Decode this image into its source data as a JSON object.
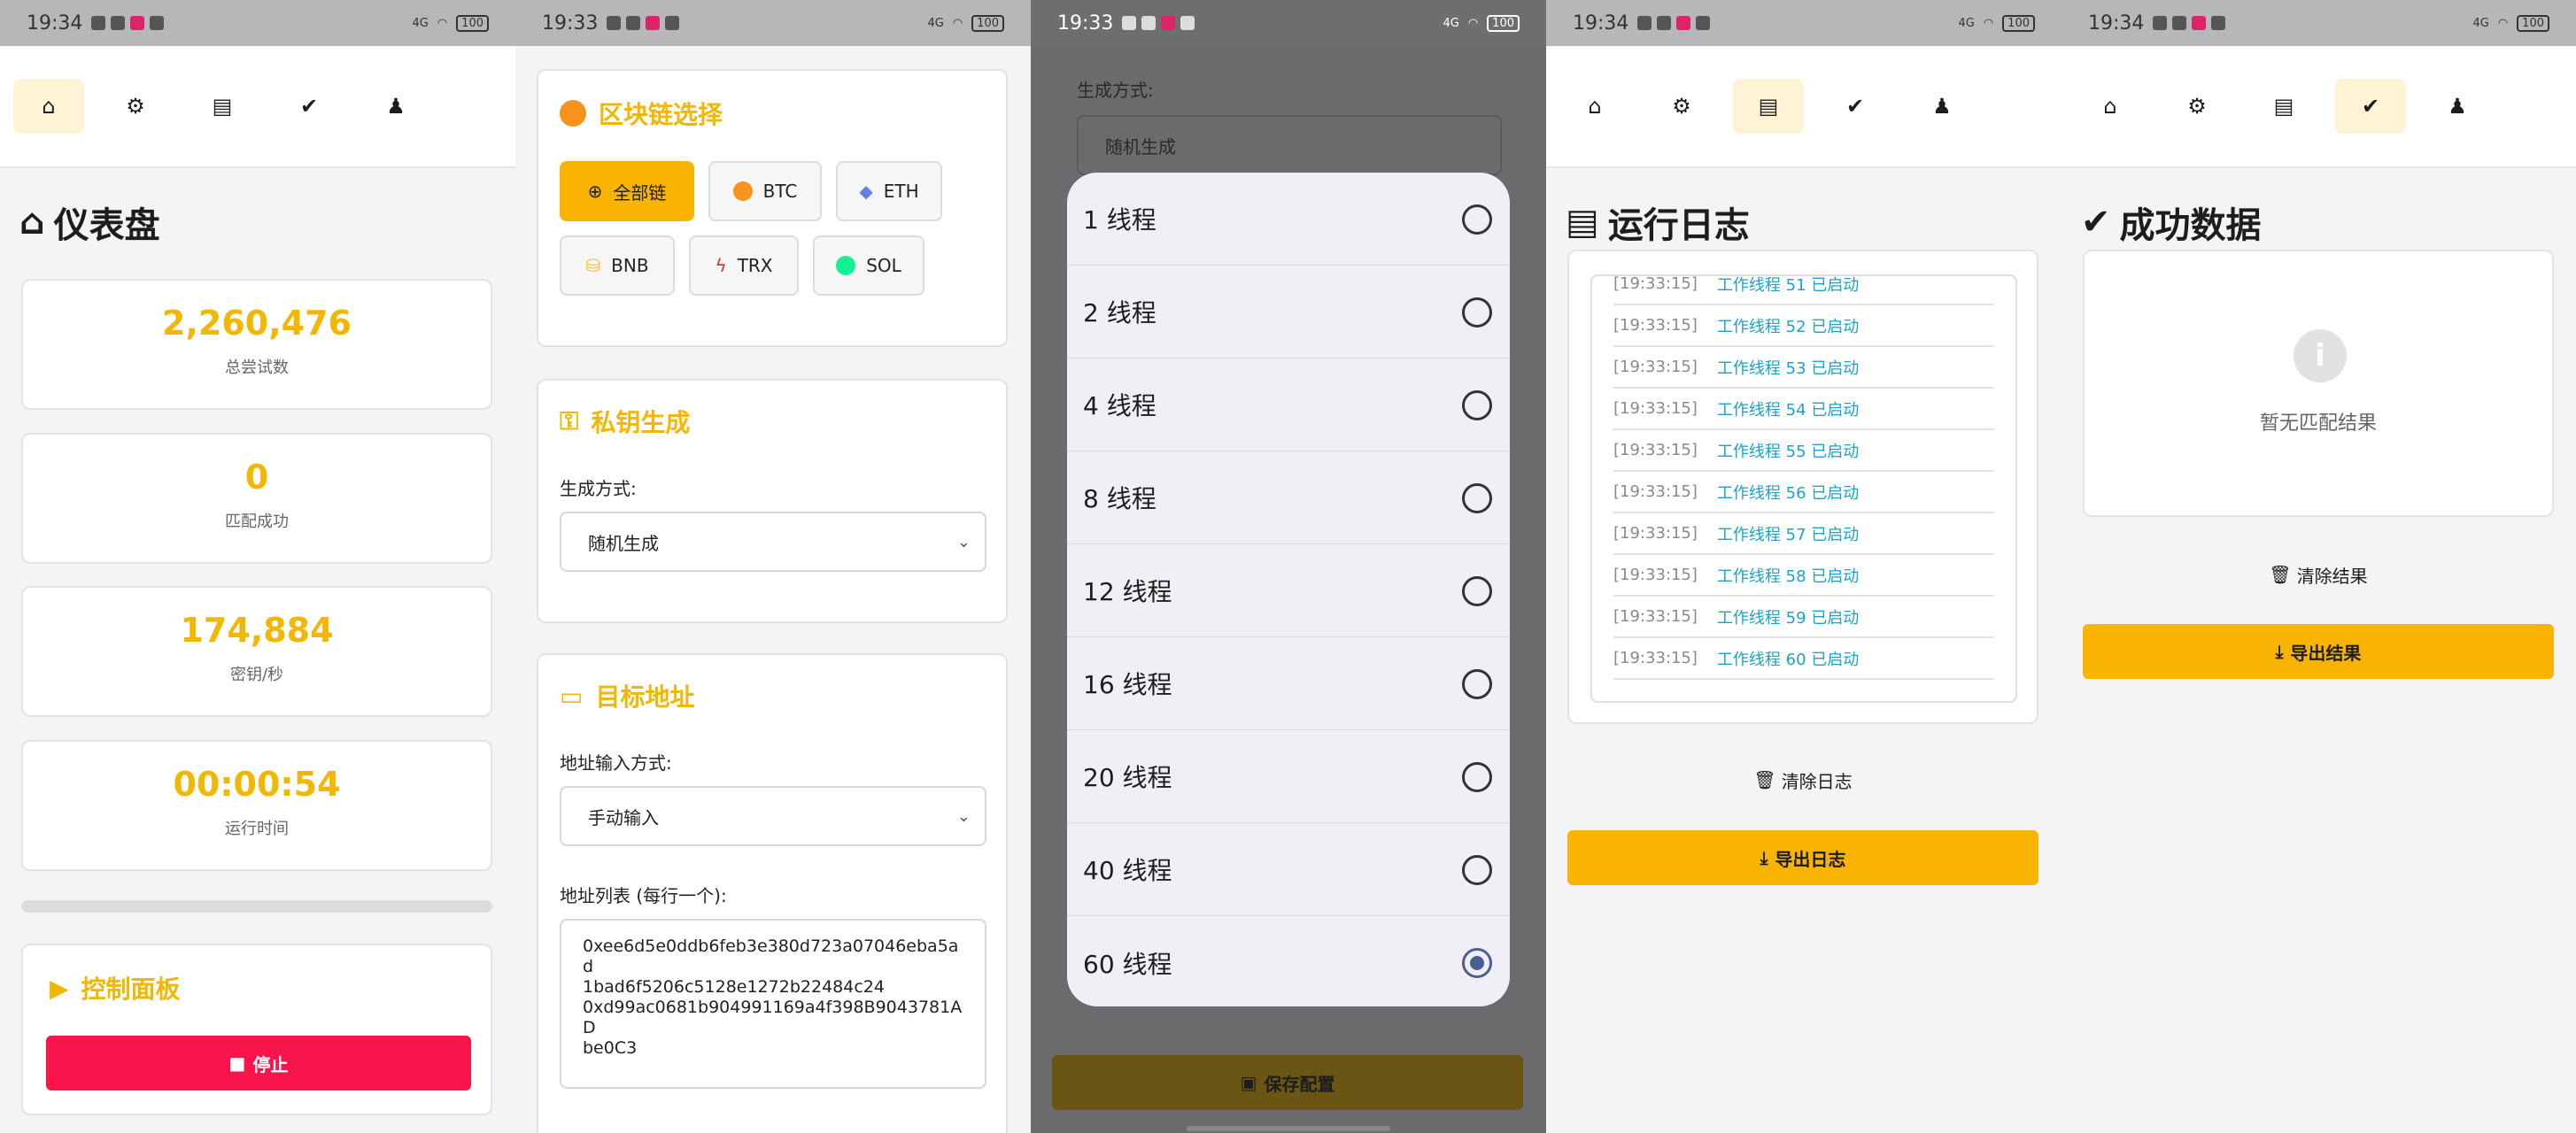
{
  "status_bars": [
    {
      "time": "19:34",
      "battery": "100"
    },
    {
      "time": "19:33",
      "battery": "100"
    },
    {
      "time": "19:33",
      "battery": "100"
    },
    {
      "time": "19:34",
      "battery": "100"
    },
    {
      "time": "19:34",
      "battery": "100"
    }
  ],
  "status_signal": "4G",
  "colors": {
    "accent": "#f8b400",
    "danger": "#f7154c",
    "log_text": "#1aa3c6"
  },
  "dashboard": {
    "title": "仪表盘",
    "stats": [
      {
        "value": "2,260,476",
        "label": "总尝试数"
      },
      {
        "value": "0",
        "label": "匹配成功"
      },
      {
        "value": "174,884",
        "label": "密钥/秒"
      },
      {
        "value": "00:00:54",
        "label": "运行时间"
      }
    ],
    "progress": 0,
    "control_title": "控制面板",
    "stop_label": "停止"
  },
  "config": {
    "chain_title": "区块链选择",
    "chains": [
      {
        "label": "全部链",
        "icon": "globe-icon",
        "active": true
      },
      {
        "label": "BTC",
        "icon": "bitcoin-icon",
        "active": false
      },
      {
        "label": "ETH",
        "icon": "ethereum-icon",
        "active": false
      },
      {
        "label": "BNB",
        "icon": "coins-icon",
        "active": false
      },
      {
        "label": "TRX",
        "icon": "bolt-icon",
        "active": false
      },
      {
        "label": "SOL",
        "icon": "circle-icon",
        "active": false
      }
    ],
    "key_title": "私钥生成",
    "gen_label": "生成方式:",
    "gen_value": "随机生成",
    "addr_title": "目标地址",
    "addr_input_label": "地址输入方式:",
    "addr_input_value": "手动输入",
    "addr_list_label": "地址列表 (每行一个):",
    "addr_list_value": "0xee6d5e0ddb6feb3e380d723a07046eba5ad\n1bad6f5206c5128e1272b22484c24\n0xd99ac0681b904991169a4f398B9043781AD\nbe0C3"
  },
  "thread_dialog": {
    "bg_label": "生成方式:",
    "bg_value": "随机生成",
    "save_label": "保存配置",
    "options": [
      {
        "label": "1 线程",
        "selected": false
      },
      {
        "label": "2 线程",
        "selected": false
      },
      {
        "label": "4 线程",
        "selected": false
      },
      {
        "label": "8 线程",
        "selected": false
      },
      {
        "label": "12 线程",
        "selected": false
      },
      {
        "label": "16 线程",
        "selected": false
      },
      {
        "label": "20 线程",
        "selected": false
      },
      {
        "label": "40 线程",
        "selected": false
      },
      {
        "label": "60 线程",
        "selected": true
      }
    ]
  },
  "logs": {
    "title": "运行日志",
    "entries": [
      {
        "ts": "[19:33:15]",
        "msg": "工作线程 51 已启动"
      },
      {
        "ts": "[19:33:15]",
        "msg": "工作线程 52 已启动"
      },
      {
        "ts": "[19:33:15]",
        "msg": "工作线程 53 已启动"
      },
      {
        "ts": "[19:33:15]",
        "msg": "工作线程 54 已启动"
      },
      {
        "ts": "[19:33:15]",
        "msg": "工作线程 55 已启动"
      },
      {
        "ts": "[19:33:15]",
        "msg": "工作线程 56 已启动"
      },
      {
        "ts": "[19:33:15]",
        "msg": "工作线程 57 已启动"
      },
      {
        "ts": "[19:33:15]",
        "msg": "工作线程 58 已启动"
      },
      {
        "ts": "[19:33:15]",
        "msg": "工作线程 59 已启动"
      },
      {
        "ts": "[19:33:15]",
        "msg": "工作线程 60 已启动"
      }
    ],
    "clear_label": "清除日志",
    "export_label": "导出日志"
  },
  "results": {
    "title": "成功数据",
    "empty_text": "暂无匹配结果",
    "clear_label": "清除结果",
    "export_label": "导出结果"
  }
}
